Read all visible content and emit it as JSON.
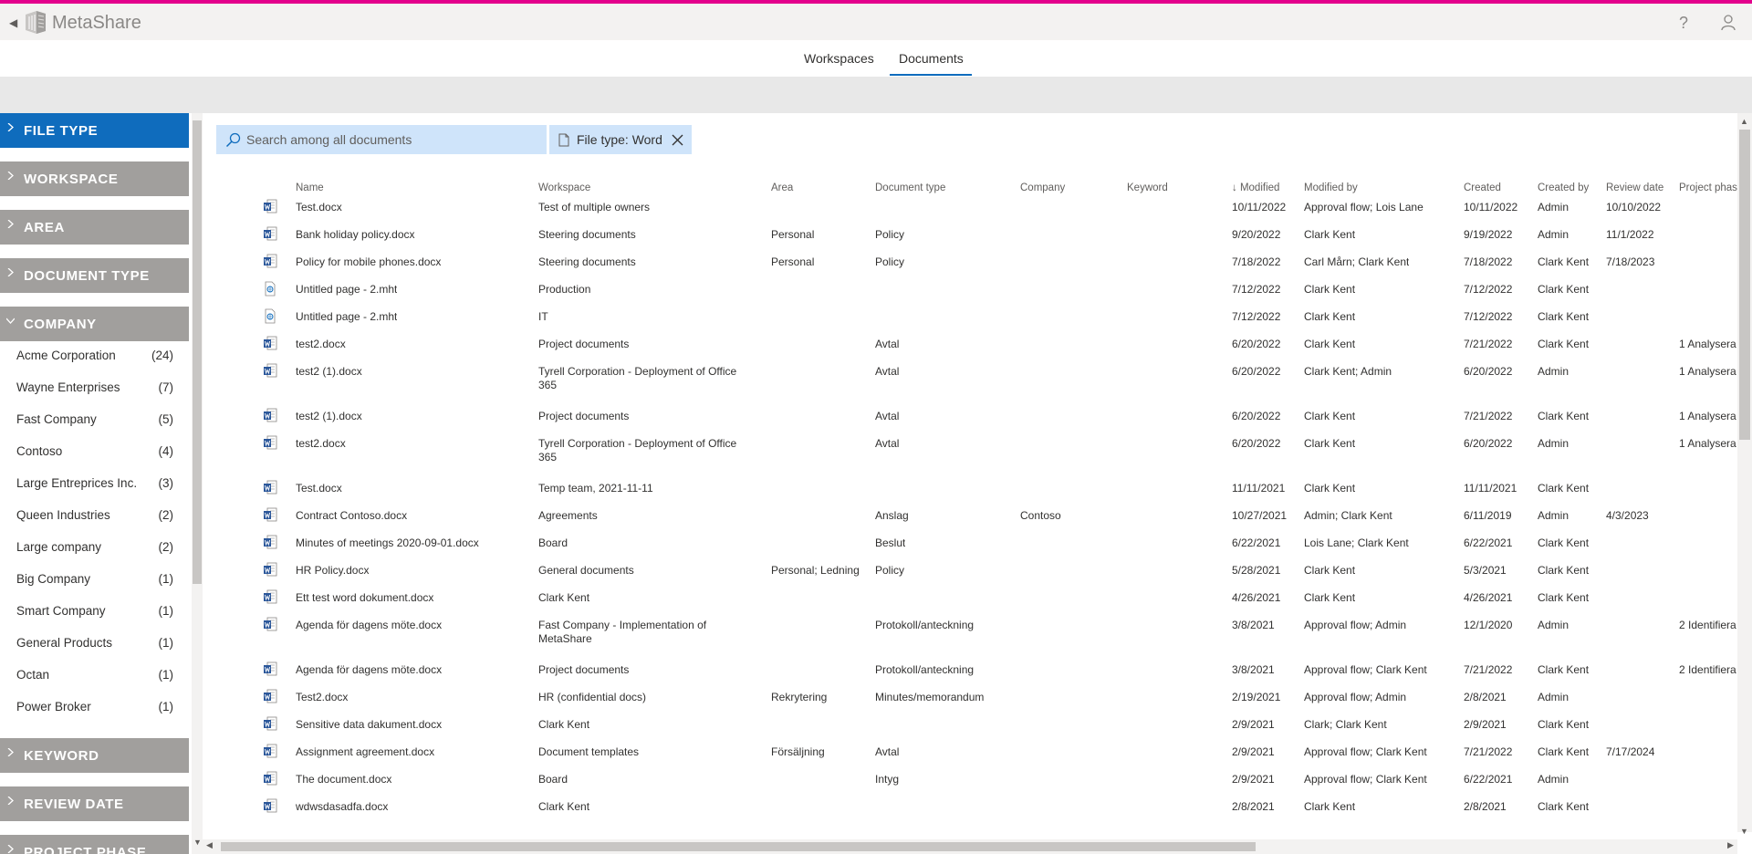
{
  "app": {
    "name": "MetaShare",
    "back_icon": "back-arrow-icon",
    "help_label": "?"
  },
  "nav": {
    "tabs": [
      {
        "label": "Workspaces"
      },
      {
        "label": "Documents"
      }
    ]
  },
  "facets": [
    {
      "label": "FILE TYPE"
    },
    {
      "label": "WORKSPACE"
    },
    {
      "label": "AREA"
    },
    {
      "label": "DOCUMENT TYPE"
    },
    {
      "label": "COMPANY"
    },
    {
      "label": "KEYWORD"
    },
    {
      "label": "REVIEW DATE"
    },
    {
      "label": "PROJECT PHASE"
    }
  ],
  "company_items": [
    {
      "name": "Acme Corporation",
      "count": "(24)"
    },
    {
      "name": "Wayne Enterprises",
      "count": "(7)"
    },
    {
      "name": "Fast Company",
      "count": "(5)"
    },
    {
      "name": "Contoso",
      "count": "(4)"
    },
    {
      "name": "Large Entreprices Inc.",
      "count": "(3)"
    },
    {
      "name": "Queen Industries",
      "count": "(2)"
    },
    {
      "name": "Large company",
      "count": "(2)"
    },
    {
      "name": "Big Company",
      "count": "(1)"
    },
    {
      "name": "Smart Company",
      "count": "(1)"
    },
    {
      "name": "General Products",
      "count": "(1)"
    },
    {
      "name": "Octan",
      "count": "(1)"
    },
    {
      "name": "Power Broker",
      "count": "(1)"
    }
  ],
  "search": {
    "placeholder": "Search among all documents"
  },
  "filter_chip": {
    "label": "File type: Word"
  },
  "columns": [
    "Name",
    "Workspace",
    "Area",
    "Document type",
    "Company",
    "Keyword",
    "Modified",
    "Modified by",
    "Created",
    "Created by",
    "Review date",
    "Project phase"
  ],
  "rows": [
    {
      "icon": "word",
      "name": "Test.docx",
      "workspace": "Test of multiple owners",
      "area": "",
      "doctype": "",
      "company": "",
      "keyword": "",
      "modified": "10/11/2022",
      "modified_by": "Approval flow; Lois Lane",
      "created": "10/11/2022",
      "created_by": "Admin",
      "review": "10/10/2022",
      "phase": ""
    },
    {
      "icon": "word",
      "name": "Bank holiday policy.docx",
      "workspace": "Steering documents",
      "area": "Personal",
      "doctype": "Policy",
      "company": "",
      "keyword": "",
      "modified": "9/20/2022",
      "modified_by": "Clark Kent",
      "created": "9/19/2022",
      "created_by": "Admin",
      "review": "11/1/2022",
      "phase": ""
    },
    {
      "icon": "word",
      "name": "Policy for mobile phones.docx",
      "workspace": "Steering documents",
      "area": "Personal",
      "doctype": "Policy",
      "company": "",
      "keyword": "",
      "modified": "7/18/2022",
      "modified_by": "Carl Mårn; Clark Kent",
      "created": "7/18/2022",
      "created_by": "Clark Kent",
      "review": "7/18/2023",
      "phase": ""
    },
    {
      "icon": "page",
      "name": "Untitled page - 2.mht",
      "workspace": "Production",
      "area": "",
      "doctype": "",
      "company": "",
      "keyword": "",
      "modified": "7/12/2022",
      "modified_by": "Clark Kent",
      "created": "7/12/2022",
      "created_by": "Clark Kent",
      "review": "",
      "phase": ""
    },
    {
      "icon": "page",
      "name": "Untitled page - 2.mht",
      "workspace": "IT",
      "area": "",
      "doctype": "",
      "company": "",
      "keyword": "",
      "modified": "7/12/2022",
      "modified_by": "Clark Kent",
      "created": "7/12/2022",
      "created_by": "Clark Kent",
      "review": "",
      "phase": ""
    },
    {
      "icon": "word",
      "name": "test2.docx",
      "workspace": "Project documents",
      "area": "",
      "doctype": "Avtal",
      "company": "",
      "keyword": "",
      "modified": "6/20/2022",
      "modified_by": "Clark Kent",
      "created": "7/21/2022",
      "created_by": "Clark Kent",
      "review": "",
      "phase": "1 Analysera"
    },
    {
      "icon": "word",
      "name": "test2 (1).docx",
      "workspace": "Tyrell Corporation - Deployment of Office 365",
      "area": "",
      "doctype": "Avtal",
      "company": "",
      "keyword": "",
      "modified": "6/20/2022",
      "modified_by": "Clark Kent; Admin",
      "created": "6/20/2022",
      "created_by": "Admin",
      "review": "",
      "phase": "1 Analysera"
    },
    {
      "icon": "word",
      "name": "test2 (1).docx",
      "workspace": "Project documents",
      "area": "",
      "doctype": "Avtal",
      "company": "",
      "keyword": "",
      "modified": "6/20/2022",
      "modified_by": "Clark Kent",
      "created": "7/21/2022",
      "created_by": "Clark Kent",
      "review": "",
      "phase": "1 Analysera"
    },
    {
      "icon": "word",
      "name": "test2.docx",
      "workspace": "Tyrell Corporation - Deployment of Office 365",
      "area": "",
      "doctype": "Avtal",
      "company": "",
      "keyword": "",
      "modified": "6/20/2022",
      "modified_by": "Clark Kent",
      "created": "6/20/2022",
      "created_by": "Admin",
      "review": "",
      "phase": "1 Analysera"
    },
    {
      "icon": "word",
      "name": "Test.docx",
      "workspace": "Temp team, 2021-11-11",
      "area": "",
      "doctype": "",
      "company": "",
      "keyword": "",
      "modified": "11/11/2021",
      "modified_by": "Clark Kent",
      "created": "11/11/2021",
      "created_by": "Clark Kent",
      "review": "",
      "phase": ""
    },
    {
      "icon": "word",
      "name": "Contract Contoso.docx",
      "workspace": "Agreements",
      "area": "",
      "doctype": "Anslag",
      "company": "Contoso",
      "keyword": "",
      "modified": "10/27/2021",
      "modified_by": "Admin; Clark Kent",
      "created": "6/11/2019",
      "created_by": "Admin",
      "review": "4/3/2023",
      "phase": ""
    },
    {
      "icon": "word",
      "name": "Minutes of meetings 2020-09-01.docx",
      "workspace": "Board",
      "area": "",
      "doctype": "Beslut",
      "company": "",
      "keyword": "",
      "modified": "6/22/2021",
      "modified_by": "Lois Lane; Clark Kent",
      "created": "6/22/2021",
      "created_by": "Clark Kent",
      "review": "",
      "phase": ""
    },
    {
      "icon": "word",
      "name": "HR Policy.docx",
      "workspace": "General documents",
      "area": "Personal; Ledning",
      "doctype": "Policy",
      "company": "",
      "keyword": "",
      "modified": "5/28/2021",
      "modified_by": "Clark Kent",
      "created": "5/3/2021",
      "created_by": "Clark Kent",
      "review": "",
      "phase": ""
    },
    {
      "icon": "word",
      "name": "Ett test word dokument.docx",
      "workspace": "Clark Kent",
      "area": "",
      "doctype": "",
      "company": "",
      "keyword": "",
      "modified": "4/26/2021",
      "modified_by": "Clark Kent",
      "created": "4/26/2021",
      "created_by": "Clark Kent",
      "review": "",
      "phase": ""
    },
    {
      "icon": "word",
      "name": "Agenda för dagens möte.docx",
      "workspace": "Fast Company - Implementation of MetaShare",
      "area": "",
      "doctype": "Protokoll/anteckning",
      "company": "",
      "keyword": "",
      "modified": "3/8/2021",
      "modified_by": "Approval flow; Admin",
      "created": "12/1/2020",
      "created_by": "Admin",
      "review": "",
      "phase": "2 Identifiera"
    },
    {
      "icon": "word",
      "name": "Agenda för dagens möte.docx",
      "workspace": "Project documents",
      "area": "",
      "doctype": "Protokoll/anteckning",
      "company": "",
      "keyword": "",
      "modified": "3/8/2021",
      "modified_by": "Approval flow; Clark Kent",
      "created": "7/21/2022",
      "created_by": "Clark Kent",
      "review": "",
      "phase": "2 Identifiera"
    },
    {
      "icon": "word",
      "name": "Test2.docx",
      "workspace": "HR (confidential docs)",
      "area": "Rekrytering",
      "doctype": "Minutes/memorandum",
      "company": "",
      "keyword": "",
      "modified": "2/19/2021",
      "modified_by": "Approval flow; Admin",
      "created": "2/8/2021",
      "created_by": "Admin",
      "review": "",
      "phase": ""
    },
    {
      "icon": "word",
      "name": "Sensitive data dakument.docx",
      "workspace": "Clark Kent",
      "area": "",
      "doctype": "",
      "company": "",
      "keyword": "",
      "modified": "2/9/2021",
      "modified_by": "Clark; Clark Kent",
      "created": "2/9/2021",
      "created_by": "Clark Kent",
      "review": "",
      "phase": ""
    },
    {
      "icon": "word",
      "name": "Assignment agreement.docx",
      "workspace": "Document templates",
      "area": "Försäljning",
      "doctype": "Avtal",
      "company": "",
      "keyword": "",
      "modified": "2/9/2021",
      "modified_by": "Approval flow; Clark Kent",
      "created": "7/21/2022",
      "created_by": "Clark Kent",
      "review": "7/17/2024",
      "phase": ""
    },
    {
      "icon": "word",
      "name": "The document.docx",
      "workspace": "Board",
      "area": "",
      "doctype": "Intyg",
      "company": "",
      "keyword": "",
      "modified": "2/9/2021",
      "modified_by": "Approval flow; Clark Kent",
      "created": "6/22/2021",
      "created_by": "Admin",
      "review": "",
      "phase": ""
    },
    {
      "icon": "word",
      "name": "wdwsdasadfa.docx",
      "workspace": "Clark Kent",
      "area": "",
      "doctype": "",
      "company": "",
      "keyword": "",
      "modified": "2/8/2021",
      "modified_by": "Clark Kent",
      "created": "2/8/2021",
      "created_by": "Clark Kent",
      "review": "",
      "phase": ""
    }
  ],
  "colors": {
    "accent": "#0f6cbd",
    "brand_stripe": "#e3008c",
    "facet_gray": "#a19f9d",
    "chip_bg": "#cfe4fa"
  }
}
